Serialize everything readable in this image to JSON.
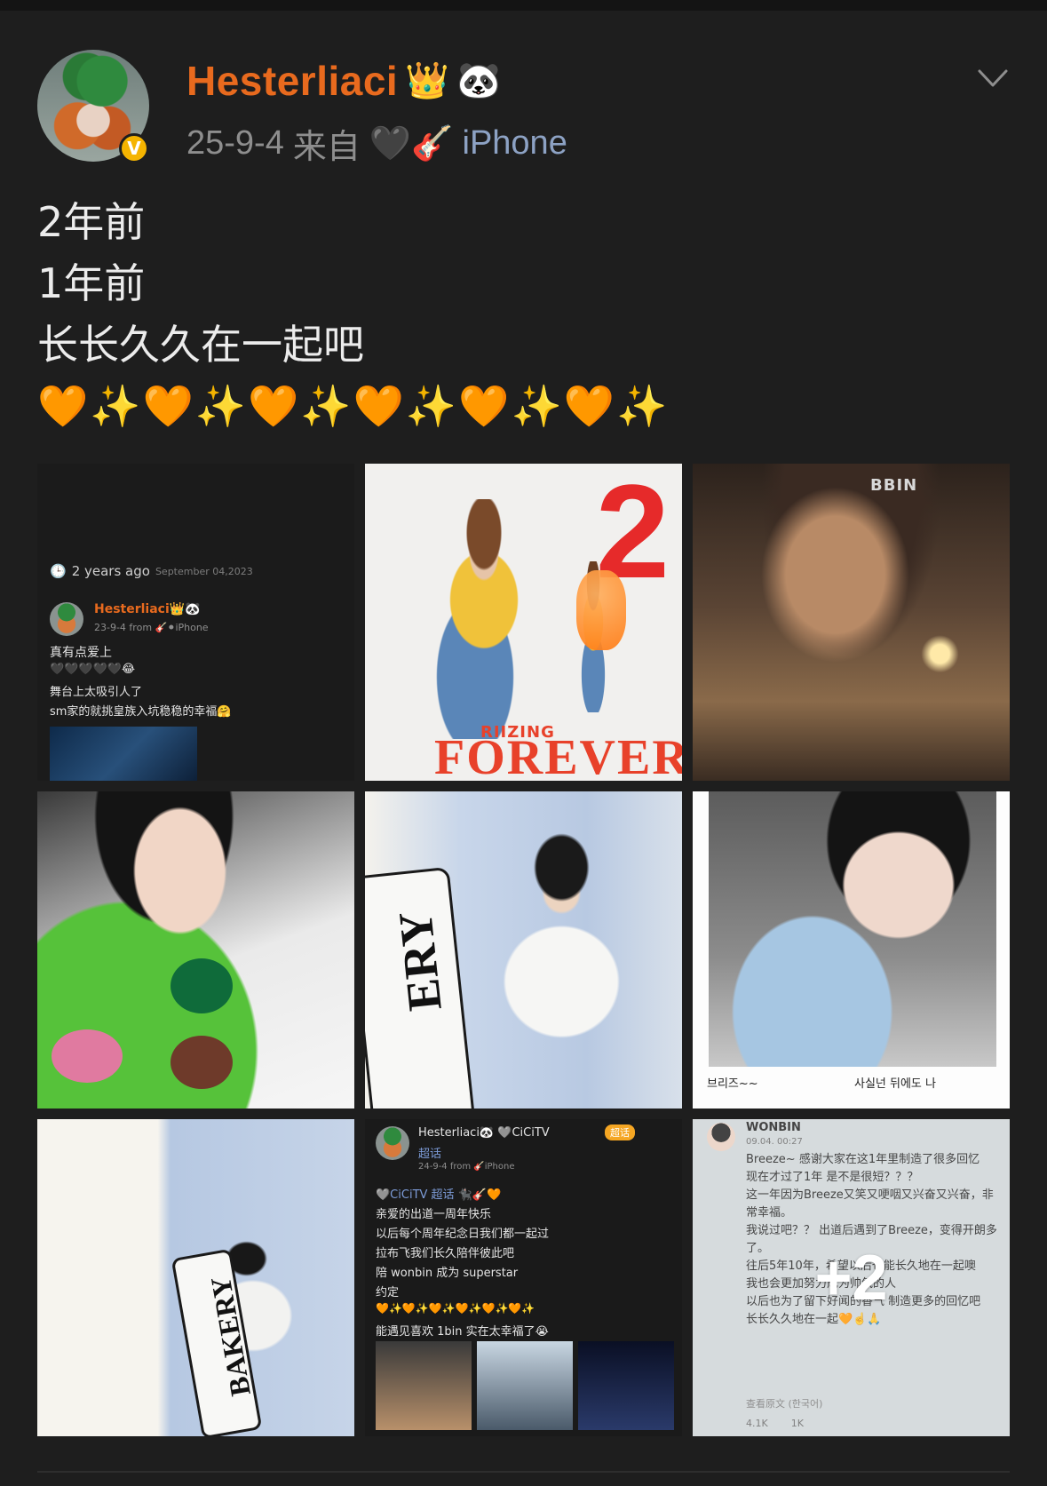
{
  "header": {
    "username": "Hesterliaci",
    "badge_icons": [
      "crown-icon",
      "panda-icon"
    ],
    "badge_glyphs": [
      "👑",
      "🐼"
    ],
    "timestamp": "25-9-4",
    "from_label": "来自",
    "source_emojis": "🖤🎸",
    "device": "iPhone",
    "verified": "V"
  },
  "post": {
    "lines": [
      "2年前",
      "1年前",
      "长长久久在一起吧"
    ],
    "emoji_line": "🧡✨🧡✨🧡✨🧡✨🧡✨🧡✨"
  },
  "grid": {
    "cells": [
      {
        "id": "screenshot-old-post",
        "clock_text": "2 years ago",
        "clock_date": "September 04,2023",
        "name": "Hesterliaci👑🐼",
        "meta": "23-9-4 from 🎸⚫iPhone",
        "line1": "真有点爱上",
        "line2": "🖤🖤🖤🖤🖤😂",
        "line3": "舞台上太吸引人了",
        "line4": "sm家的就挑皇族入坑稳稳的幸福🤗"
      },
      {
        "id": "poster-riizing-forever",
        "big_text": "2",
        "brand": "RIIZING",
        "title": "FOREVER"
      },
      {
        "id": "candle-portrait",
        "cap_text": "BBIN"
      },
      {
        "id": "selfie-with-cake"
      },
      {
        "id": "bakery-standing",
        "sign_text": "ERY"
      },
      {
        "id": "photo-card",
        "caption_left": "브리즈~~",
        "caption_right": "사실넌 뒤에도 나"
      },
      {
        "id": "bakery-crouch",
        "sign_text": "BAKERY"
      },
      {
        "id": "weibo-screenshot",
        "name": "Hesterliaci🐼 🩶CiCiTV",
        "topic": "超话",
        "tag": "超话",
        "meta": "24-9-4 from 🎸iPhone",
        "lines": [
          "🩶CiCiTV 超话 🐈‍⬛🎸🧡",
          "亲爱的出道一周年快乐",
          "以后每个周年纪念日我们都一起过",
          "拉布飞我们长久陪伴彼此吧",
          "陪 wonbin 成为 superstar",
          "约定",
          "🧡✨🧡✨🧡✨🧡✨🧡✨🧡✨",
          "能遇见喜欢 1bin 实在太幸福了😭"
        ]
      },
      {
        "id": "wonbin-post",
        "name": "WONBIN",
        "date": "09.04. 00:27",
        "lines": [
          "Breeze~ 感谢大家在这1年里制造了很多回忆",
          "现在才过了1年 是不是很短？？？",
          "这一年因为Breeze又笑又哽咽又兴奋又兴奋，非常幸福。",
          "我说过吧？？ 出道后遇到了Breeze，变得开朗多了。",
          "往后5年10年，希望以后也能长久地在一起噢",
          "我也会更加努力成为帅气的人",
          "以后也为了留下好闻的香气 制造更多的回忆吧",
          "长长久久地在一起🧡☝️🙏"
        ],
        "view_original": "查看原文 (한국어)",
        "likes": "4.1K",
        "comments": "1K",
        "more_overlay": "+2"
      }
    ]
  },
  "colors": {
    "background": "#1e1e1e",
    "username": "#e86a1e",
    "meta": "#8e8e8e",
    "device": "#8da2c4",
    "text": "#ececec",
    "verified": "#f5b400"
  }
}
